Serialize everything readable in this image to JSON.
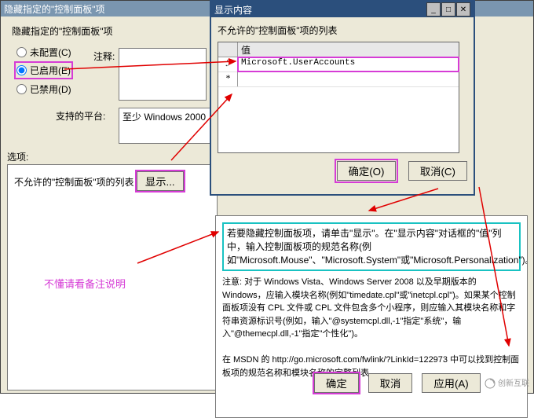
{
  "back_window": {
    "title": "隐藏指定的\"控制面板\"项",
    "policy_text": "隐藏指定的\"控制面板\"项",
    "radios": {
      "not_configured": "未配置(C)",
      "enabled": "已启用(E)",
      "disabled": "已禁用(D)"
    },
    "comment_label": "注释:",
    "platforms_label": "支持的平台:",
    "platforms_value": "至少 Windows 2000",
    "options_label": "选项:",
    "options_panel": {
      "list_label": "不允许的\"控制面板\"项的列表",
      "show_button": "显示..."
    },
    "help": {
      "highlighted": "若要隐藏控制面板项，请单击\"显示\"。在\"显示内容\"对话框的\"值\"列中，输入控制面板项的规范名称(例如\"Microsoft.Mouse\"、\"Microsoft.System\"或\"Microsoft.Personalization\")。",
      "rest": "注意: 对于 Windows Vista、Windows Server 2008 以及早期版本的 Windows，应输入模块名称(例如\"timedate.cpl\"或\"inetcpl.cpl\")。如果某个控制面板项没有 CPL 文件或 CPL 文件包含多个小程序，则应输入其模块名称和字符串资源标识号(例如，输入\"@systemcpl.dll,-1\"指定\"系统\"，输入\"@themecpl.dll,-1\"指定\"个性化\")。\n\n在 MSDN 的 http://go.microsoft.com/fwlink/?LinkId=122973 中可以找到控制面板项的规范名称和模块名称的完整列表。"
    },
    "note": "不懂请看备注说明",
    "bottom_buttons": {
      "ok": "确定",
      "cancel": "取消",
      "apply": "应用(A)"
    }
  },
  "front_window": {
    "title": "显示内容",
    "label": "不允许的\"控制面板\"项的列表",
    "grid_header": "值",
    "rows": [
      {
        "marker": "ℐ",
        "value": "Microsoft.UserAccounts"
      },
      {
        "marker": "*",
        "value": ""
      }
    ],
    "ok": "确定(O)",
    "cancel": "取消(C)"
  },
  "watermark": "创新互联"
}
